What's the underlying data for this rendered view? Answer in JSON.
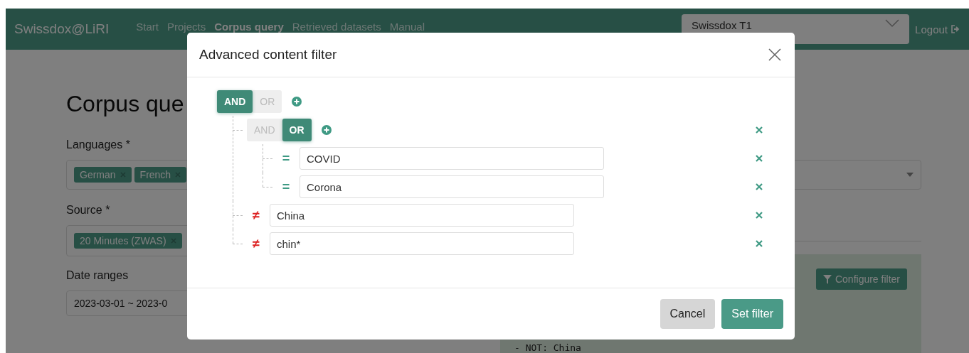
{
  "navbar": {
    "brand": "Swissdox@LiRI",
    "links": [
      {
        "label": "Start",
        "selected": false
      },
      {
        "label": "Projects",
        "selected": false
      },
      {
        "label": "Corpus query",
        "selected": true
      },
      {
        "label": "Retrieved datasets",
        "selected": false
      },
      {
        "label": "Manual",
        "selected": false
      }
    ],
    "workspace": {
      "value": "Swissdox T1"
    },
    "logout": "Logout"
  },
  "page": {
    "title": "Corpus que",
    "languages": {
      "label": "Languages *",
      "chips": [
        "German",
        "French"
      ]
    },
    "source": {
      "label": "Source *",
      "chips": [
        "20 Minutes (ZWAS)"
      ]
    },
    "date_ranges": {
      "label": "Date ranges",
      "value": "2023-03-01 ~ 2023-0"
    },
    "filter_panel": {
      "button": "Configure filter",
      "code": "- NOT: China"
    }
  },
  "modal": {
    "title": "Advanced content filter",
    "root": {
      "kind": "group",
      "operators": [
        {
          "label": "AND",
          "selected": true
        },
        {
          "label": "OR",
          "selected": false
        }
      ],
      "children": [
        {
          "kind": "group",
          "operators": [
            {
              "label": "AND",
              "selected": false
            },
            {
              "label": "OR",
              "selected": true
            }
          ],
          "children": [
            {
              "kind": "term",
              "operator": "=",
              "negated": false,
              "value": "COVID"
            },
            {
              "kind": "term",
              "operator": "=",
              "negated": false,
              "value": "Corona"
            }
          ]
        },
        {
          "kind": "term",
          "operator": "≠",
          "negated": true,
          "value": "China"
        },
        {
          "kind": "term",
          "operator": "≠",
          "negated": true,
          "value": "chin*"
        }
      ]
    },
    "buttons": [
      {
        "label": "Cancel",
        "kind": "secondary"
      },
      {
        "label": "Set filter",
        "kind": "primary"
      }
    ]
  }
}
